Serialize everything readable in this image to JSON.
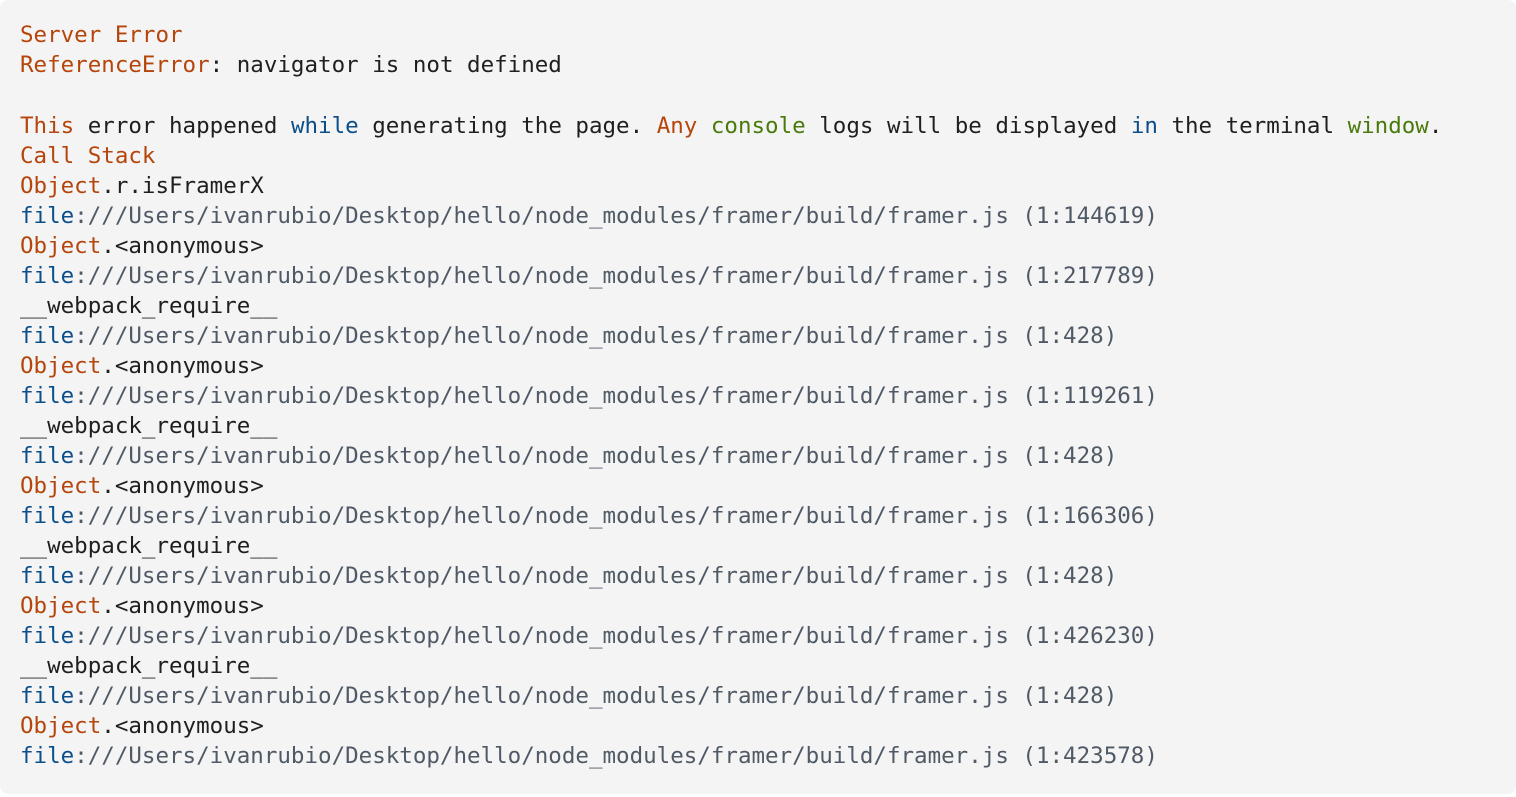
{
  "error_overlay": {
    "title": "Server Error",
    "error_type": "ReferenceError",
    "error_message": ": navigator is not defined",
    "description": {
      "w1": "This",
      "t1": " error happened ",
      "w2": "while",
      "t2": " generating the page. ",
      "w3": "Any",
      "t3": " ",
      "w4": "console",
      "t4": " logs will be displayed ",
      "w5": "in",
      "t5": " the terminal ",
      "w6": "window",
      "t6": "."
    },
    "call_stack_heading": "Call Stack",
    "frames": [
      {
        "obj": "Object",
        "fn": ".r.isFramerX",
        "scheme": "file",
        "path": ":///Users/ivanrubio/Desktop/hello/node_modules/framer/build/framer.js (1:144619)"
      },
      {
        "obj": "Object",
        "fn": ".<anonymous>",
        "scheme": "file",
        "path": ":///Users/ivanrubio/Desktop/hello/node_modules/framer/build/framer.js (1:217789)"
      },
      {
        "obj": "",
        "fn": "__webpack_require__",
        "scheme": "file",
        "path": ":///Users/ivanrubio/Desktop/hello/node_modules/framer/build/framer.js (1:428)"
      },
      {
        "obj": "Object",
        "fn": ".<anonymous>",
        "scheme": "file",
        "path": ":///Users/ivanrubio/Desktop/hello/node_modules/framer/build/framer.js (1:119261)"
      },
      {
        "obj": "",
        "fn": "__webpack_require__",
        "scheme": "file",
        "path": ":///Users/ivanrubio/Desktop/hello/node_modules/framer/build/framer.js (1:428)"
      },
      {
        "obj": "Object",
        "fn": ".<anonymous>",
        "scheme": "file",
        "path": ":///Users/ivanrubio/Desktop/hello/node_modules/framer/build/framer.js (1:166306)"
      },
      {
        "obj": "",
        "fn": "__webpack_require__",
        "scheme": "file",
        "path": ":///Users/ivanrubio/Desktop/hello/node_modules/framer/build/framer.js (1:428)"
      },
      {
        "obj": "Object",
        "fn": ".<anonymous>",
        "scheme": "file",
        "path": ":///Users/ivanrubio/Desktop/hello/node_modules/framer/build/framer.js (1:426230)"
      },
      {
        "obj": "",
        "fn": "__webpack_require__",
        "scheme": "file",
        "path": ":///Users/ivanrubio/Desktop/hello/node_modules/framer/build/framer.js (1:428)"
      },
      {
        "obj": "Object",
        "fn": ".<anonymous>",
        "scheme": "file",
        "path": ":///Users/ivanrubio/Desktop/hello/node_modules/framer/build/framer.js (1:423578)"
      }
    ]
  }
}
